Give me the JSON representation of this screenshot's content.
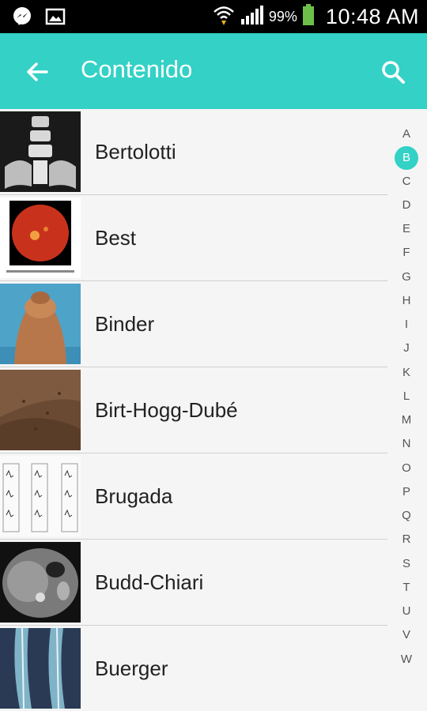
{
  "status_bar": {
    "battery": "99%",
    "time": "10:48 AM",
    "left_icons": [
      "messenger-icon",
      "gallery-icon"
    ],
    "right_icons": [
      "wifi-icon",
      "signal-icon",
      "battery-icon"
    ]
  },
  "toolbar": {
    "title": "Contenido",
    "back_icon": "arrow-left-icon",
    "search_icon": "search-icon",
    "color": "#33d1c6"
  },
  "items": [
    {
      "label": "Bertolotti",
      "thumb": "x-ray spine"
    },
    {
      "label": "Best",
      "thumb": "retina"
    },
    {
      "label": "Binder",
      "thumb": "face profile"
    },
    {
      "label": "Birt-Hogg-Dubé",
      "thumb": "skin"
    },
    {
      "label": "Brugada",
      "thumb": "ecg"
    },
    {
      "label": "Budd-Chiari",
      "thumb": "ct scan"
    },
    {
      "label": "Buerger",
      "thumb": "angiography"
    }
  ],
  "index": {
    "letters": [
      "A",
      "B",
      "C",
      "D",
      "E",
      "F",
      "G",
      "H",
      "I",
      "J",
      "K",
      "L",
      "M",
      "N",
      "O",
      "P",
      "Q",
      "R",
      "S",
      "T",
      "U",
      "V",
      "W"
    ],
    "active": "B"
  }
}
